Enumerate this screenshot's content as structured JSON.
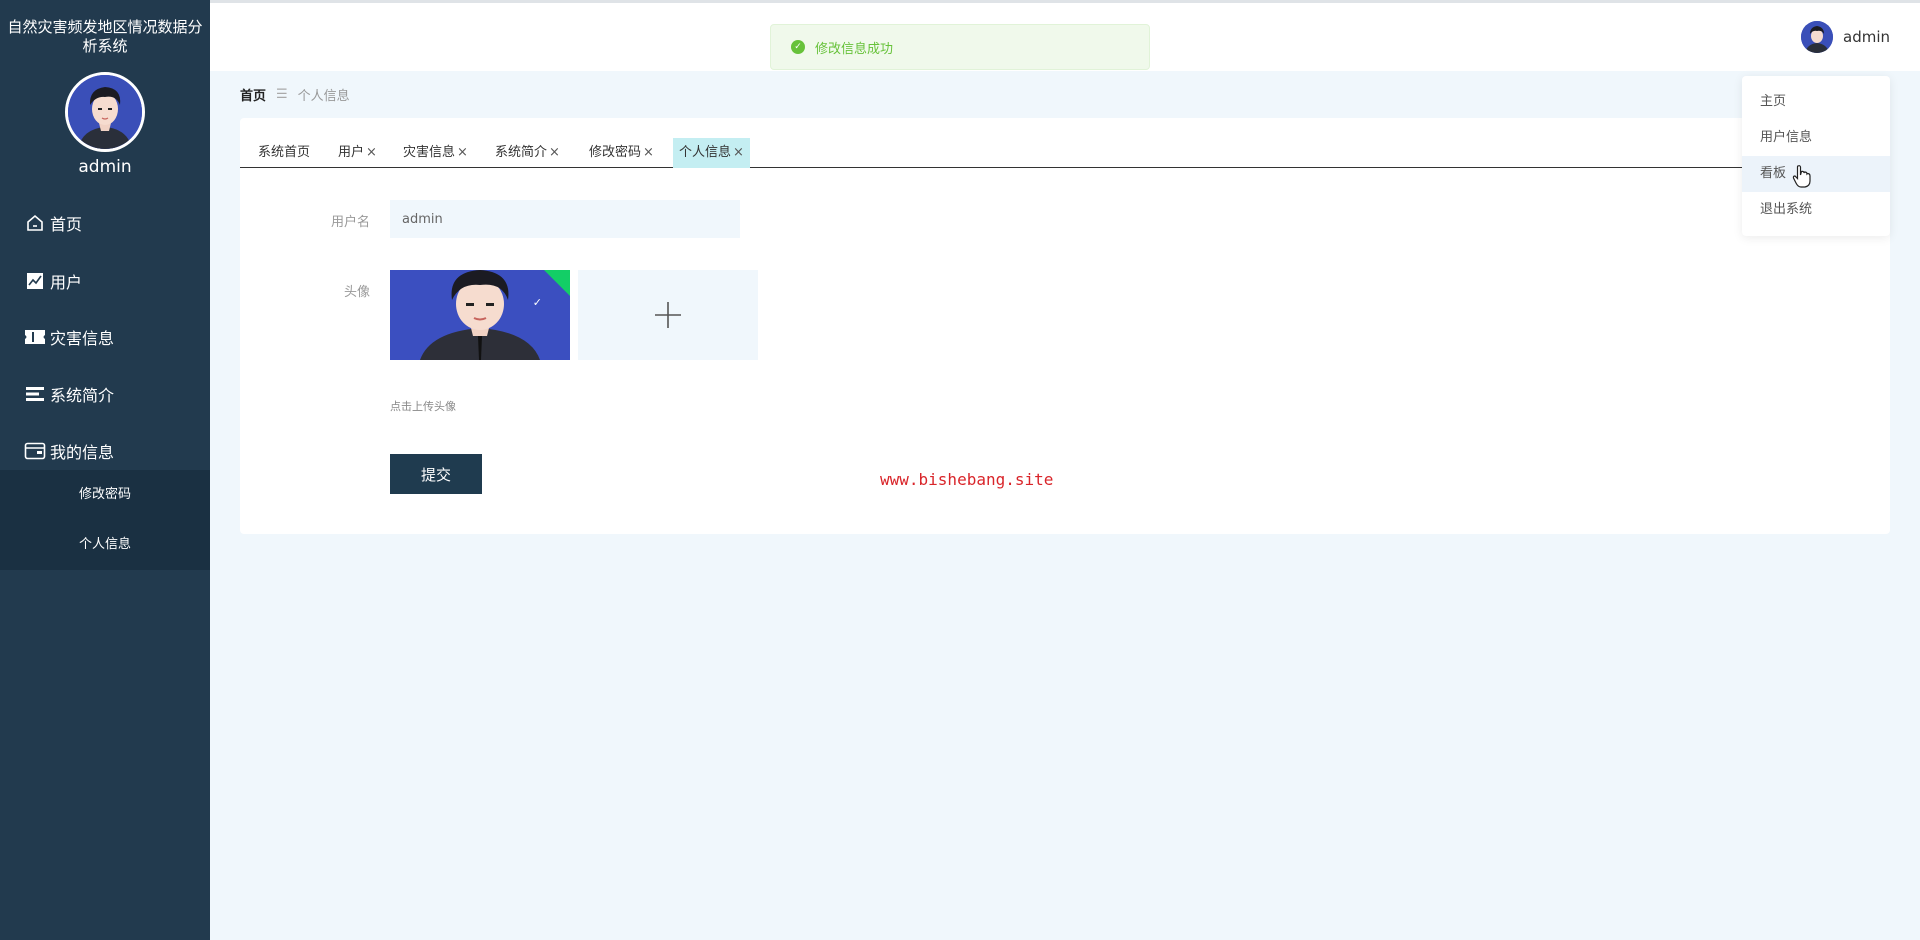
{
  "sidebar": {
    "system_title": "自然灾害频发地区情况数据分析系统",
    "username": "admin",
    "menu": [
      {
        "label": "首页",
        "icon": "home-icon"
      },
      {
        "label": "用户",
        "icon": "chart-icon"
      },
      {
        "label": "灾害信息",
        "icon": "ticket-icon"
      },
      {
        "label": "系统简介",
        "icon": "list-icon"
      },
      {
        "label": "我的信息",
        "icon": "wallet-icon"
      }
    ],
    "submenu": [
      {
        "label": "修改密码"
      },
      {
        "label": "个人信息"
      }
    ]
  },
  "header": {
    "username": "admin"
  },
  "toast": {
    "message": "修改信息成功"
  },
  "dropdown": {
    "items": [
      {
        "label": "主页"
      },
      {
        "label": "用户信息"
      },
      {
        "label": "看板"
      },
      {
        "label": "退出系统"
      }
    ]
  },
  "breadcrumb": {
    "home": "首页",
    "separator": "☰",
    "current": "个人信息"
  },
  "tabs": [
    {
      "label": "系统首页",
      "closable": false
    },
    {
      "label": "用户",
      "closable": true
    },
    {
      "label": "灾害信息",
      "closable": true
    },
    {
      "label": "系统简介",
      "closable": true
    },
    {
      "label": "修改密码",
      "closable": true
    },
    {
      "label": "个人信息",
      "closable": true
    }
  ],
  "form": {
    "username_label": "用户名",
    "username_value": "admin",
    "avatar_label": "头像",
    "upload_hint": "点击上传头像",
    "submit_label": "提交"
  },
  "watermark": "www.bishebang.site",
  "colors": {
    "sidebar_bg": "#223a4e",
    "submenu_bg": "#1a3042",
    "active_tab": "#c4eef2",
    "success": "#67c23a",
    "page_bg": "#f0f7fc",
    "submit_bg": "#1f3b4f",
    "watermark": "#d9252a"
  }
}
